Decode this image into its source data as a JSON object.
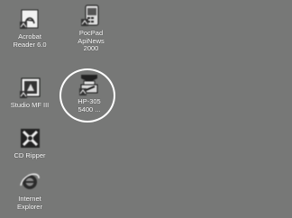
{
  "desktop": {
    "background": "#777877",
    "highlight_color": "#ffffff",
    "icons": [
      {
        "label": "Acrobat\nReader 6.0",
        "icon": "acrobat-reader-icon"
      },
      {
        "label": "PocPad\nApiNews\n2000",
        "icon": "pocket-app-icon"
      },
      {
        "label": "Studio MF III",
        "icon": "studio-mf-icon"
      },
      {
        "label": "HP-305\n5400 ...",
        "icon": "hp-scanner-icon"
      },
      {
        "label": "CD Ripper",
        "icon": "cd-ripper-icon"
      },
      {
        "label": "Internet\nExplorer",
        "icon": "internet-explorer-icon"
      }
    ]
  }
}
